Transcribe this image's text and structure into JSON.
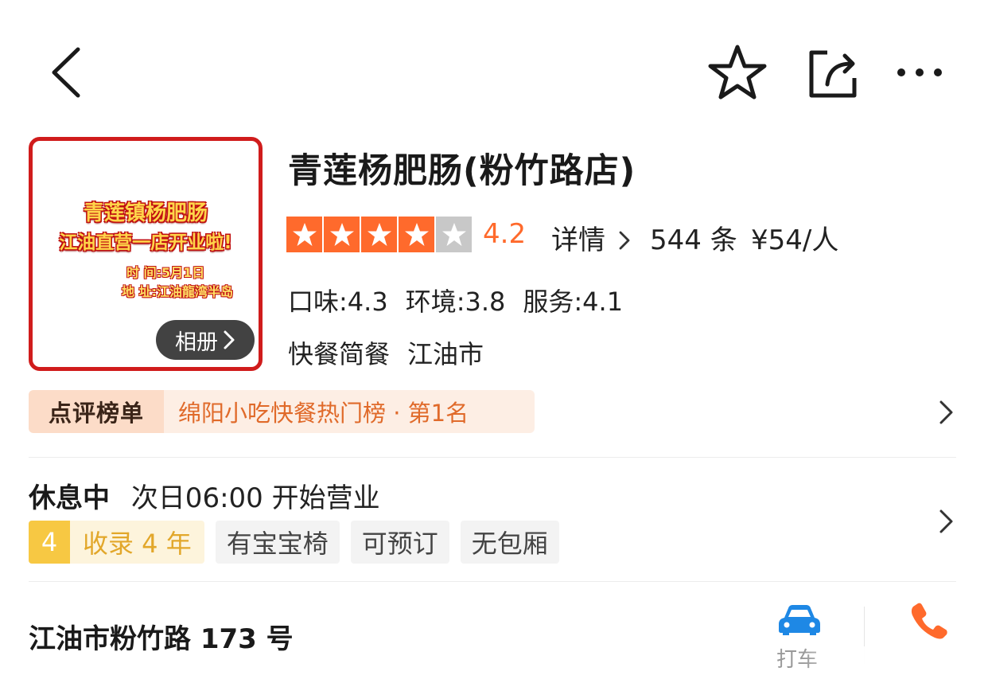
{
  "header": {
    "back_icon": "chevron-left-icon",
    "favorite_icon": "star-outline-icon",
    "share_icon": "share-icon",
    "more_icon": "more-dots-icon"
  },
  "shop": {
    "name": "青莲杨肥肠(粉竹路店)",
    "photo": {
      "poster_line_1": "青莲镇杨肥肠",
      "poster_line_2": "江油直营一店开业啦!",
      "poster_time": "时 间:5月1日",
      "poster_address": "地 址:江油龍湾半岛",
      "album_label": "相册"
    },
    "rating": {
      "stars_filled": 4,
      "stars_total": 5,
      "score": "4.2",
      "details_label": "详情",
      "review_count": "544 条",
      "avg_price": "¥54/人"
    },
    "sub_scores": [
      {
        "label": "口味:4.3"
      },
      {
        "label": "环境:3.8"
      },
      {
        "label": "服务:4.1"
      }
    ],
    "category": "快餐简餐",
    "city": "江油市"
  },
  "ranking": {
    "badge": "点评榜单",
    "text": "绵阳小吃快餐热门榜 · 第1名"
  },
  "status": {
    "state": "休息中",
    "next_open": "次日06:00 开始营业"
  },
  "badges": {
    "years_number": "4",
    "years_text": "收录 4 年",
    "features": [
      "有宝宝椅",
      "可预订",
      "无包厢"
    ]
  },
  "address": {
    "text": "江油市粉竹路 173 号",
    "taxi_label": "打车",
    "taxi_icon": "car-icon",
    "phone_icon": "phone-icon"
  },
  "colors": {
    "accent": "#ff6a2c",
    "taxi_blue": "#1e88e5",
    "year_gold": "#f7c843"
  }
}
